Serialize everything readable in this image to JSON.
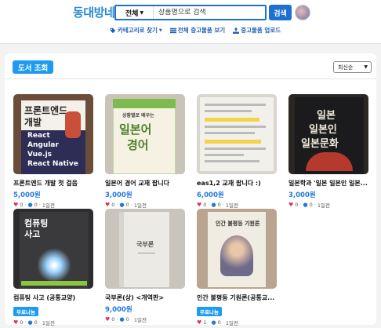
{
  "header": {
    "logo": "동대방네",
    "search": {
      "category": "전체",
      "placeholder": "상품명으로 검색",
      "button": "검색"
    },
    "nav": [
      {
        "label": "카테고리로 찾기",
        "icon": "tags-icon"
      },
      {
        "label": "전체 중고물품 보기",
        "icon": "list-icon"
      },
      {
        "label": "중고물품 업로드",
        "icon": "upload-icon"
      }
    ]
  },
  "main": {
    "title": "도서 조회",
    "sort": "최신순",
    "products": [
      {
        "title": "프론트엔드 개발 첫 걸음",
        "price": "5,000원",
        "likes": "0",
        "comments": "0",
        "time": "1일전",
        "cover": {
          "lines": [
            "프론트엔드",
            "개발",
            "React",
            "Angular",
            "Vue.js",
            "React Native"
          ]
        }
      },
      {
        "title": "일본어 경어 교재 팝니다",
        "price": "3,000원",
        "likes": "0",
        "comments": "0",
        "time": "1일전",
        "cover": {
          "lines": [
            "상황별로 배우는",
            "일본어",
            "경어"
          ]
        }
      },
      {
        "title": "eas1,2 교재 팝니다 :)",
        "price": "6,000원",
        "likes": "0",
        "comments": "0",
        "time": "1일전",
        "cover": {
          "lines": []
        }
      },
      {
        "title": "일본학과 '일본 일본인 일본...",
        "price": "3,000원",
        "likes": "0",
        "comments": "0",
        "time": "1일전",
        "cover": {
          "lines": [
            "일본",
            "일본인",
            "일본문화"
          ]
        }
      },
      {
        "title": "컴퓨팅 사고 (공통교양)",
        "badge": "무료나눔",
        "likes": "0",
        "comments": "0",
        "time": "1일전",
        "cover": {
          "lines": [
            "컴퓨팅",
            "사고"
          ]
        }
      },
      {
        "title": "국부론(상) <개역판>",
        "price": "9,000원",
        "likes": "0",
        "comments": "0",
        "time": "1일전",
        "cover": {
          "lines": [
            "국부론"
          ]
        }
      },
      {
        "title": "인간 불평등 기원론(공통교...",
        "badge": "무료나눔",
        "likes": "1",
        "comments": "0",
        "time": "1일전",
        "cover": {
          "lines": [
            "인간 불평등 기원론"
          ]
        }
      }
    ]
  },
  "colors": {
    "accent": "#1e9bf0",
    "primary": "#1f6fd1",
    "heart": "#e0335a",
    "price": "#1f7ae0"
  }
}
